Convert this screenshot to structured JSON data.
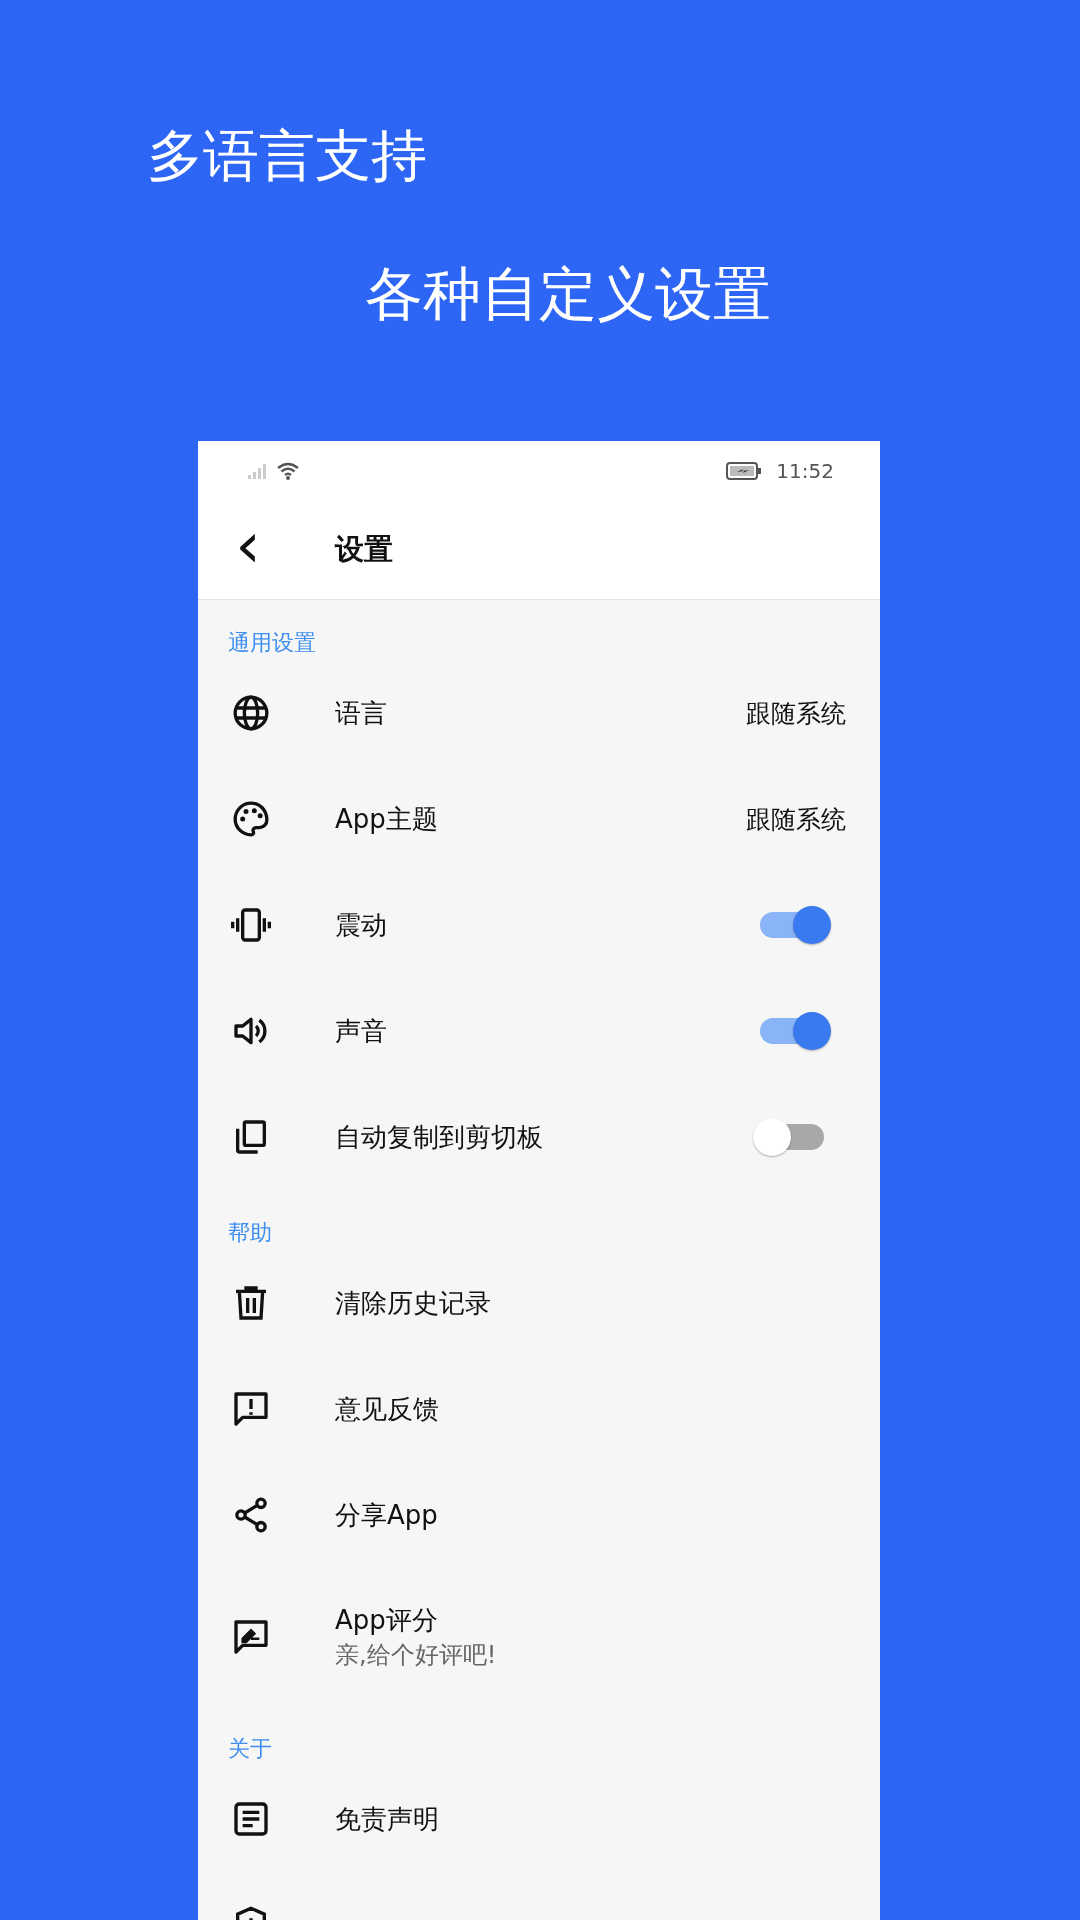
{
  "headlines": [
    "多语言支持",
    "各种自定义设置"
  ],
  "status_bar": {
    "time": "11:52"
  },
  "toolbar": {
    "back": "‹",
    "title": "设置"
  },
  "sections": [
    {
      "header": "通用设置",
      "items": [
        {
          "kind": "value",
          "label": "语言",
          "value": "跟随系统"
        },
        {
          "kind": "value",
          "label": "App主题",
          "value": "跟随系统"
        },
        {
          "kind": "toggle",
          "label": "震动",
          "on": true
        },
        {
          "kind": "toggle",
          "label": "声音",
          "on": true
        },
        {
          "kind": "toggle",
          "label": "自动复制到剪切板",
          "on": false
        }
      ]
    },
    {
      "header": "帮助",
      "items": [
        {
          "kind": "link",
          "label": "清除历史记录"
        },
        {
          "kind": "link",
          "label": "意见反馈"
        },
        {
          "kind": "link",
          "label": "分享App"
        },
        {
          "kind": "subtitle",
          "label": "App评分",
          "subtitle": "亲,给个好评吧!"
        }
      ]
    },
    {
      "header": "关于",
      "items": [
        {
          "kind": "link",
          "label": "免责声明"
        },
        {
          "kind": "link"
        }
      ]
    }
  ]
}
